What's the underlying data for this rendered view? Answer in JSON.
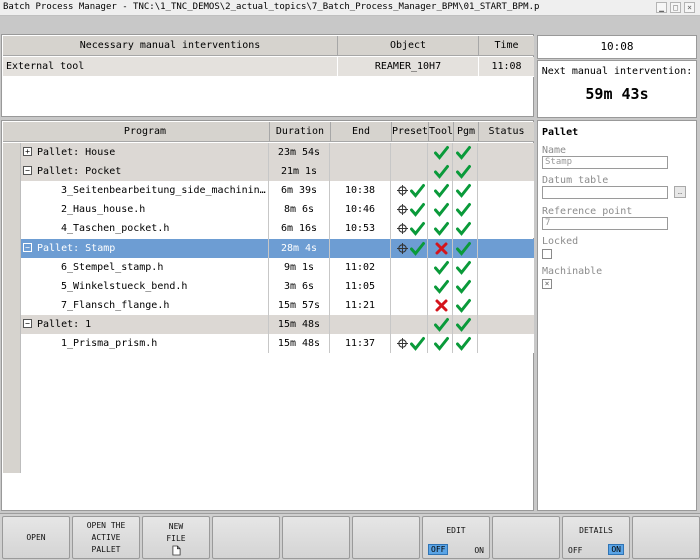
{
  "window": {
    "title": "Batch Process Manager - TNC:\\1_TNC_DEMOS\\2_actual_topics\\7_Batch_Process_Manager_BPM\\01_START_BPM.p"
  },
  "interventions": {
    "headers": [
      "Necessary manual interventions",
      "Object",
      "Time"
    ],
    "rows": [
      {
        "text": "External tool",
        "object": "REAMER_10H7",
        "time": "11:08"
      }
    ]
  },
  "clock": {
    "time": "10:08",
    "next_label": "Next manual intervention:",
    "next_value": "59m 43s"
  },
  "program_table": {
    "headers": [
      "Program",
      "Duration",
      "End",
      "Preset",
      "Tool",
      "Pgm",
      "Status"
    ],
    "rows": [
      {
        "kind": "group",
        "expander": "+",
        "program": "Pallet: House",
        "duration": "23m 54s",
        "end": "",
        "preset": "",
        "tool": "ok",
        "pgm": "ok"
      },
      {
        "kind": "group",
        "expander": "−",
        "program": "Pallet: Pocket",
        "duration": "21m 1s",
        "end": "",
        "preset": "",
        "tool": "ok",
        "pgm": "ok"
      },
      {
        "kind": "item",
        "program": "3_Seitenbearbeitung_side_machinin…",
        "duration": "6m 39s",
        "end": "10:38",
        "preset": "ok",
        "tool": "ok",
        "pgm": "ok"
      },
      {
        "kind": "item",
        "program": "2_Haus_house.h",
        "duration": "8m 6s",
        "end": "10:46",
        "preset": "ok",
        "tool": "ok",
        "pgm": "ok"
      },
      {
        "kind": "item",
        "program": "4_Taschen_pocket.h",
        "duration": "6m 16s",
        "end": "10:53",
        "preset": "ok",
        "tool": "ok",
        "pgm": "ok"
      },
      {
        "kind": "selected",
        "expander": "−",
        "program": "Pallet: Stamp",
        "duration": "28m 4s",
        "end": "",
        "preset": "ok",
        "tool": "error",
        "pgm": "ok"
      },
      {
        "kind": "item",
        "program": "6_Stempel_stamp.h",
        "duration": "9m 1s",
        "end": "11:02",
        "preset": "",
        "tool": "ok",
        "pgm": "ok"
      },
      {
        "kind": "item",
        "program": "5_Winkelstueck_bend.h",
        "duration": "3m 6s",
        "end": "11:05",
        "preset": "",
        "tool": "ok",
        "pgm": "ok"
      },
      {
        "kind": "item",
        "program": "7_Flansch_flange.h",
        "duration": "15m 57s",
        "end": "11:21",
        "preset": "",
        "tool": "error",
        "pgm": "ok"
      },
      {
        "kind": "group",
        "expander": "−",
        "program": "Pallet: 1",
        "duration": "15m 48s",
        "end": "",
        "preset": "",
        "tool": "ok",
        "pgm": "ok"
      },
      {
        "kind": "item",
        "program": "1_Prisma_prism.h",
        "duration": "15m 48s",
        "end": "11:37",
        "preset": "ok",
        "tool": "ok",
        "pgm": "ok"
      }
    ]
  },
  "pallet_detail": {
    "title": "Pallet",
    "name_label": "Name",
    "name_value": "Stamp",
    "datum_label": "Datum table",
    "datum_value": "",
    "ref_label": "Reference point",
    "ref_value": "7",
    "locked_label": "Locked",
    "machinable_label": "Machinable"
  },
  "softkeys": [
    {
      "lines": [
        "OPEN"
      ]
    },
    {
      "lines": [
        "OPEN THE",
        "ACTIVE",
        "PALLET"
      ]
    },
    {
      "lines": [
        "NEW",
        "FILE"
      ],
      "icon": "file-icon"
    },
    {
      "lines": []
    },
    {
      "lines": []
    },
    {
      "lines": []
    },
    {
      "lines": [
        "EDIT"
      ],
      "toggle": {
        "off": "OFF",
        "on": "ON",
        "active": "off"
      }
    },
    {
      "lines": []
    },
    {
      "lines": [
        "DETAILS"
      ],
      "toggle": {
        "off": "OFF",
        "on": "ON",
        "active": "on"
      }
    },
    {
      "lines": []
    }
  ],
  "colors": {
    "check": "#0a9a3a",
    "error": "#d4141c",
    "selection": "#6d9dd3"
  }
}
